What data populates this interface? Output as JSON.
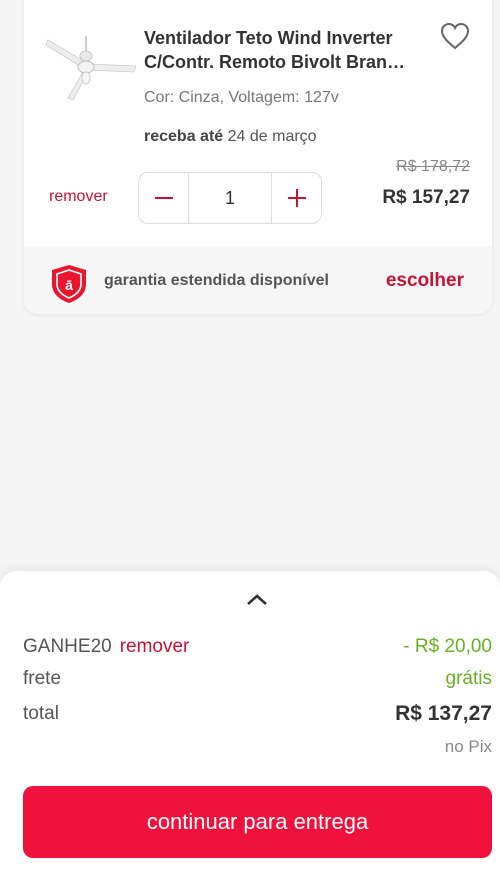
{
  "cart_item": {
    "title": "Ventilador Teto Wind Inverter C/Contr. Remoto Bivolt Bran…",
    "variant": "Cor: Cinza, Voltagem: 127v",
    "delivery_label": "receba até",
    "delivery_date": "24 de março",
    "remove_label": "remover",
    "quantity": "1",
    "old_price": "R$ 178,72",
    "price": "R$ 157,27",
    "thumbnail_icon": "ceiling-fan",
    "favorite_icon": "heart-outline",
    "minus_icon": "minus",
    "plus_icon": "plus"
  },
  "warranty": {
    "icon": "shield-a",
    "text": "garantia estendida disponível",
    "action": "escolher"
  },
  "summary": {
    "expand_icon": "chevron-up",
    "coupon_code": "GANHE20",
    "coupon_remove": "remover",
    "coupon_discount": "- R$ 20,00",
    "shipping_label": "frete",
    "shipping_value": "grátis",
    "total_label": "total",
    "total_value": "R$ 137,27",
    "payment_note": "no Pix",
    "cta": "continuar para entrega"
  },
  "colors": {
    "brand_red": "#f0123c",
    "text_red": "#c41432",
    "discount_green": "#6ab023",
    "background": "#f5f5f5"
  }
}
